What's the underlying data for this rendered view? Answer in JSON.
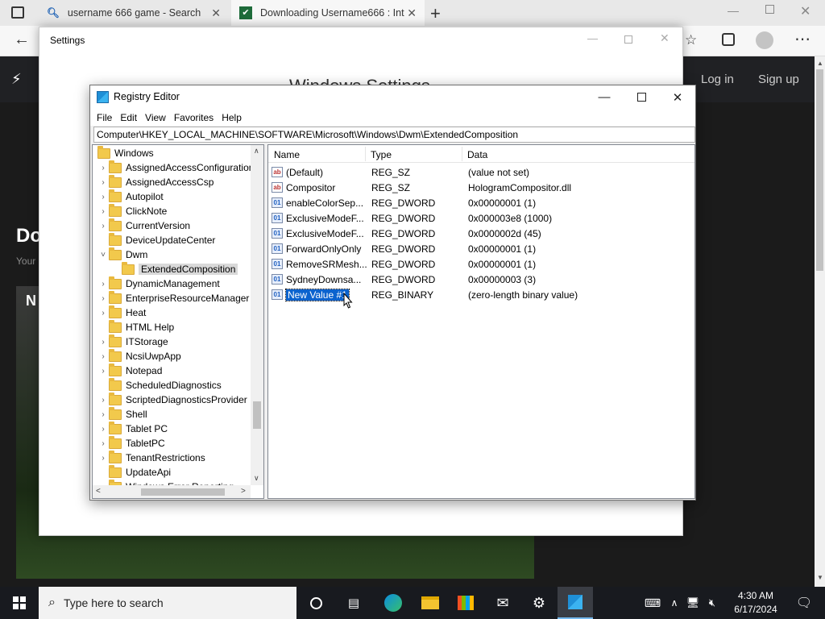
{
  "browser": {
    "tabs": [
      {
        "title": "username 666 game - Search",
        "icon": "search-icon"
      },
      {
        "title": "Downloading Username666 : Int",
        "icon": "site-icon"
      }
    ],
    "site": {
      "login": "Log in",
      "signup": "Sign up",
      "heading_partial": "Do",
      "sub_partial": "Your",
      "card_partial": "N"
    }
  },
  "settings": {
    "title": "Settings",
    "heading_partial": "Windows Settings"
  },
  "regedit": {
    "title": "Registry Editor",
    "menu": [
      "File",
      "Edit",
      "View",
      "Favorites",
      "Help"
    ],
    "address": "Computer\\HKEY_LOCAL_MACHINE\\SOFTWARE\\Microsoft\\Windows\\Dwm\\ExtendedComposition",
    "tree": [
      {
        "label": "Windows",
        "level": 0,
        "chev": ""
      },
      {
        "label": "AssignedAccessConfiguration",
        "level": 1,
        "chev": ">"
      },
      {
        "label": "AssignedAccessCsp",
        "level": 1,
        "chev": ">"
      },
      {
        "label": "Autopilot",
        "level": 1,
        "chev": ">"
      },
      {
        "label": "ClickNote",
        "level": 1,
        "chev": ">"
      },
      {
        "label": "CurrentVersion",
        "level": 1,
        "chev": ">"
      },
      {
        "label": "DeviceUpdateCenter",
        "level": 1,
        "chev": ""
      },
      {
        "label": "Dwm",
        "level": 1,
        "chev": "v"
      },
      {
        "label": "ExtendedComposition",
        "level": 2,
        "chev": "",
        "selected": true
      },
      {
        "label": "DynamicManagement",
        "level": 1,
        "chev": ">"
      },
      {
        "label": "EnterpriseResourceManager",
        "level": 1,
        "chev": ">"
      },
      {
        "label": "Heat",
        "level": 1,
        "chev": ">"
      },
      {
        "label": "HTML Help",
        "level": 1,
        "chev": ""
      },
      {
        "label": "ITStorage",
        "level": 1,
        "chev": ">"
      },
      {
        "label": "NcsiUwpApp",
        "level": 1,
        "chev": ">"
      },
      {
        "label": "Notepad",
        "level": 1,
        "chev": ">"
      },
      {
        "label": "ScheduledDiagnostics",
        "level": 1,
        "chev": ""
      },
      {
        "label": "ScriptedDiagnosticsProvider",
        "level": 1,
        "chev": ">"
      },
      {
        "label": "Shell",
        "level": 1,
        "chev": ">"
      },
      {
        "label": "Tablet PC",
        "level": 1,
        "chev": ">"
      },
      {
        "label": "TabletPC",
        "level": 1,
        "chev": ">"
      },
      {
        "label": "TenantRestrictions",
        "level": 1,
        "chev": ">"
      },
      {
        "label": "UpdateApi",
        "level": 1,
        "chev": ""
      },
      {
        "label": "Windows Error Reporting",
        "level": 1,
        "chev": ">"
      }
    ],
    "columns": {
      "name": "Name",
      "type": "Type",
      "data": "Data"
    },
    "values": [
      {
        "name": "(Default)",
        "type": "REG_SZ",
        "data": "(value not set)",
        "kind": "sz"
      },
      {
        "name": "Compositor",
        "type": "REG_SZ",
        "data": "HologramCompositor.dll",
        "kind": "sz"
      },
      {
        "name": "enableColorSep...",
        "type": "REG_DWORD",
        "data": "0x00000001 (1)",
        "kind": "bin"
      },
      {
        "name": "ExclusiveModeF...",
        "type": "REG_DWORD",
        "data": "0x000003e8 (1000)",
        "kind": "bin"
      },
      {
        "name": "ExclusiveModeF...",
        "type": "REG_DWORD",
        "data": "0x0000002d (45)",
        "kind": "bin"
      },
      {
        "name": "ForwardOnlyOnly",
        "type": "REG_DWORD",
        "data": "0x00000001 (1)",
        "kind": "bin"
      },
      {
        "name": "RemoveSRMesh...",
        "type": "REG_DWORD",
        "data": "0x00000001 (1)",
        "kind": "bin"
      },
      {
        "name": "SydneyDownsa...",
        "type": "REG_DWORD",
        "data": "0x00000003 (3)",
        "kind": "bin"
      },
      {
        "name": "New Value #1",
        "type": "REG_BINARY",
        "data": "(zero-length binary value)",
        "kind": "bin",
        "selected": true
      }
    ]
  },
  "taskbar": {
    "search_placeholder": "Type here to search",
    "time": "4:30 AM",
    "date": "6/17/2024"
  }
}
